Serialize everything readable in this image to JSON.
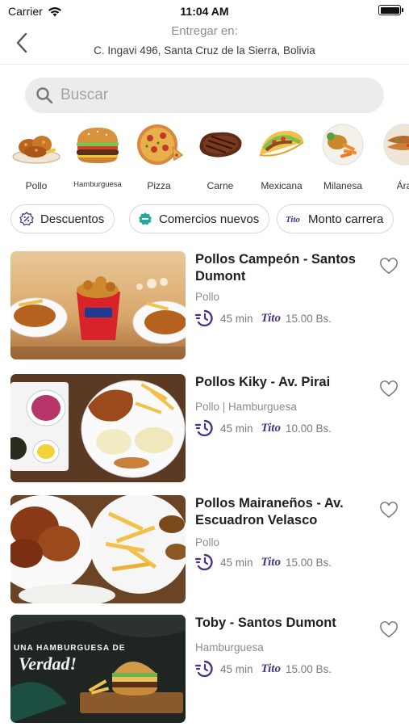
{
  "status": {
    "carrier": "Carrier",
    "time": "11:04 AM"
  },
  "header": {
    "deliver_label": "Entregar en:",
    "address": "C. Ingavi 496, Santa Cruz de la Sierra, Bolivia"
  },
  "search": {
    "placeholder": "Buscar"
  },
  "categories": [
    {
      "label": "Pollo",
      "icon": "fried-chicken-icon"
    },
    {
      "label": "Hamburguesa",
      "icon": "burger-icon"
    },
    {
      "label": "Pizza",
      "icon": "pizza-icon"
    },
    {
      "label": "Carne",
      "icon": "steak-icon"
    },
    {
      "label": "Mexicana",
      "icon": "taco-icon"
    },
    {
      "label": "Milanesa",
      "icon": "milanesa-icon"
    },
    {
      "label": "Ára",
      "icon": "arabic-food-icon"
    }
  ],
  "chips": [
    {
      "label": "Descuentos",
      "icon": "discount-icon"
    },
    {
      "label": "Comercios nuevos",
      "icon": "new-badge-icon"
    },
    {
      "label": "Monto carrera",
      "icon": "tito-icon"
    }
  ],
  "brand": {
    "tito": "Tito",
    "accent": "#4a2f8f"
  },
  "restaurants": [
    {
      "name": "Pollos Campeón - Santos Dumont",
      "category": "Pollo",
      "time": "45 min",
      "price": "15.00 Bs."
    },
    {
      "name": "Pollos Kiky - Av. Pirai",
      "category": "Pollo | Hamburguesa",
      "time": "45 min",
      "price": "10.00 Bs."
    },
    {
      "name": "Pollos Mairaneños - Av. Escuadron Velasco",
      "category": "Pollo",
      "time": "45 min",
      "price": "15.00 Bs."
    },
    {
      "name": "Toby - Santos Dumont",
      "category": "Hamburguesa",
      "time": "45 min",
      "price": "15.00 Bs.",
      "banner_text_1": "UNA HAMBURGUESA DE",
      "banner_text_2": "Verdad!"
    }
  ]
}
